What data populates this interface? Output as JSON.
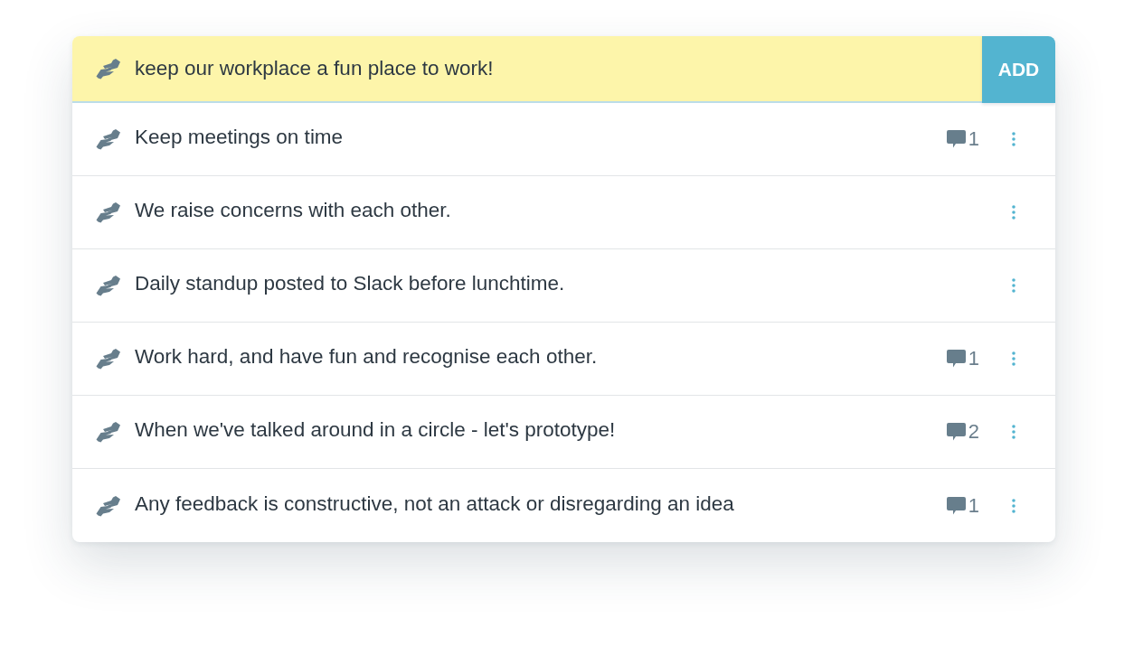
{
  "new_item": {
    "value": "keep our workplace a fun place to work!",
    "button": "ADD"
  },
  "items": [
    {
      "text": "Keep meetings on time",
      "comments": "1"
    },
    {
      "text": "We raise concerns with each other."
    },
    {
      "text": "Daily standup posted to Slack before lunchtime."
    },
    {
      "text": "Work hard, and have fun and recognise each other.",
      "comments": "1"
    },
    {
      "text": "When we've talked around in a circle - let's prototype!",
      "comments": "2"
    },
    {
      "text": "Any feedback is constructive, not an attack or disregarding an idea",
      "comments": "1"
    }
  ]
}
